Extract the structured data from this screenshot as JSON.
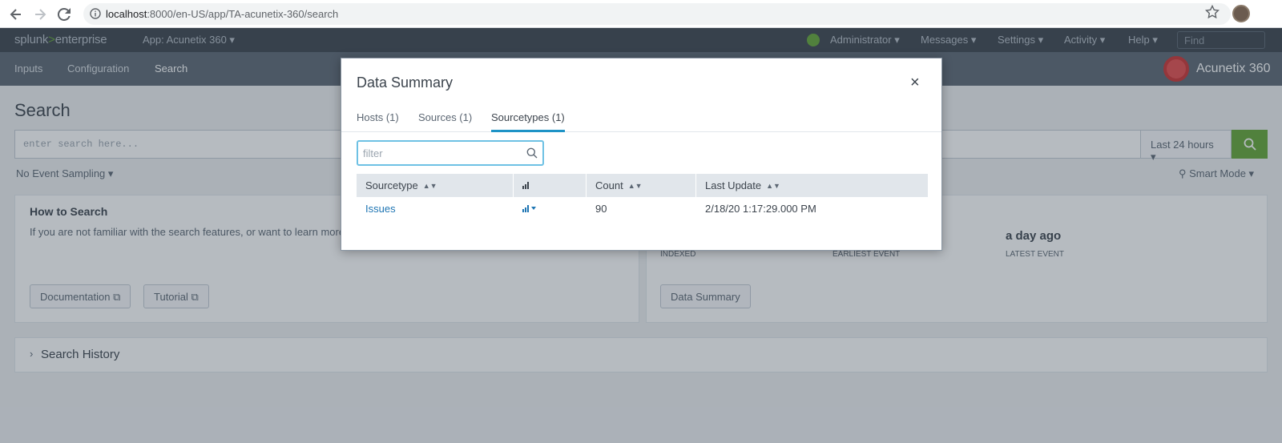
{
  "browser": {
    "url_host": "localhost",
    "url_path": ":8000/en-US/app/TA-acunetix-360/search"
  },
  "splunk_bar": {
    "logo_left": "splunk",
    "logo_gt": ">",
    "logo_right": "enterprise",
    "app_menu": "App: Acunetix 360 ▾",
    "nav": [
      "Administrator ▾",
      "Messages ▾",
      "Settings ▾",
      "Activity ▾",
      "Help ▾"
    ],
    "find_placeholder": "Find"
  },
  "app_bar": {
    "items": [
      "Inputs",
      "Configuration",
      "Search"
    ],
    "app_title": "Acunetix 360"
  },
  "search_page": {
    "title": "Search",
    "search_placeholder": "enter search here...",
    "time_range": "Last 24 hours ▾",
    "sampling": "No Event Sampling ▾",
    "mode": "Smart Mode ▾"
  },
  "how_to": {
    "title": "How to Search",
    "text": "If you are not familiar with the search features, or want to learn more",
    "doc_button": "Documentation",
    "tutorial_button": "Tutorial"
  },
  "what_to": {
    "latest_value": "a day ago",
    "indexed_label": "INDEXED",
    "earliest_label": "EARLIEST EVENT",
    "latest_label": "LATEST EVENT",
    "summary_button": "Data Summary"
  },
  "history": {
    "label": "Search History"
  },
  "modal": {
    "title": "Data Summary",
    "close": "×",
    "tabs": [
      "Hosts (1)",
      "Sources (1)",
      "Sourcetypes (1)"
    ],
    "filter_placeholder": "filter",
    "columns": [
      "Sourcetype",
      "",
      "Count",
      "Last Update"
    ],
    "rows": [
      {
        "sourcetype": "Issues",
        "count": "90",
        "last_update": "2/18/20 1:17:29.000 PM"
      }
    ]
  },
  "colors": {
    "accent": "#1e93c6",
    "splunk_green": "#65a637",
    "link": "#1e75b3"
  }
}
